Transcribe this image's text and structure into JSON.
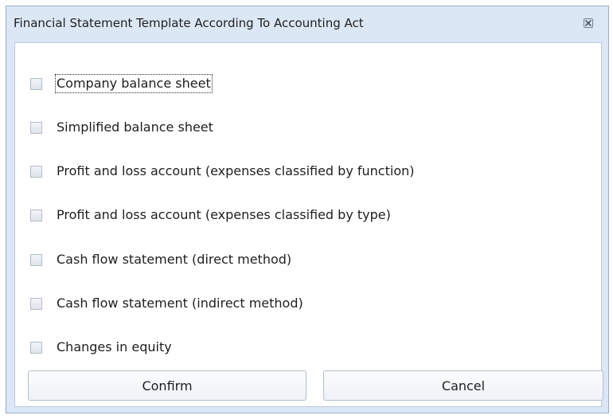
{
  "window": {
    "title": "Financial Statement Template According To Accounting Act",
    "close_icon": "close-icon"
  },
  "options": [
    {
      "label": "Company balance sheet",
      "checked": false,
      "focused": true
    },
    {
      "label": "Simplified balance sheet",
      "checked": false,
      "focused": false
    },
    {
      "label": "Profit and loss account (expenses classified by function)",
      "checked": false,
      "focused": false
    },
    {
      "label": "Profit and loss account (expenses classified by type)",
      "checked": false,
      "focused": false
    },
    {
      "label": "Cash flow statement (direct method)",
      "checked": false,
      "focused": false
    },
    {
      "label": "Cash flow statement (indirect method)",
      "checked": false,
      "focused": false
    },
    {
      "label": "Changes in equity",
      "checked": false,
      "focused": false
    }
  ],
  "buttons": {
    "confirm_label": "Confirm",
    "cancel_label": "Cancel"
  },
  "colors": {
    "frame": "#dce7f5",
    "border": "#9aaec6",
    "content_bg": "#ffffff"
  }
}
